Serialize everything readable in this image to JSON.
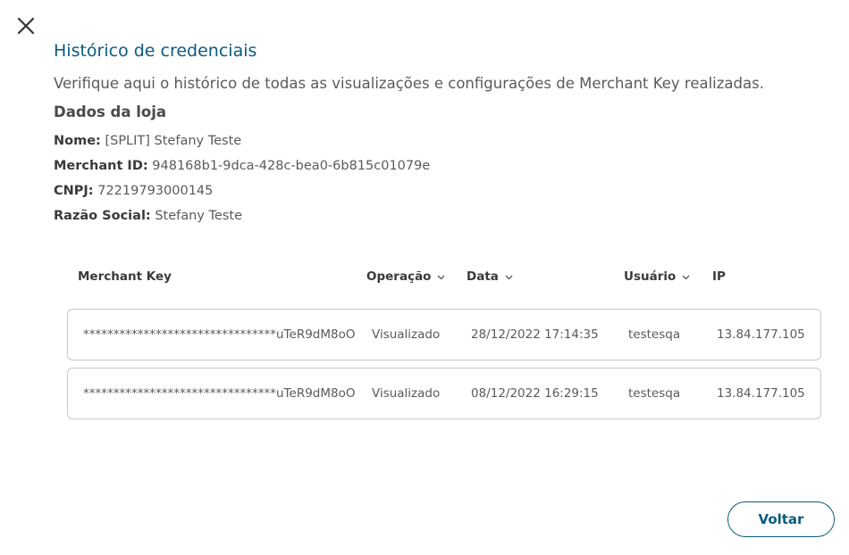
{
  "modal": {
    "title": "Histórico de credenciais",
    "subtitle": "Verifique aqui o histórico de todas as visualizações e configurações de Merchant Key realizadas.",
    "close_icon": "close-icon"
  },
  "store": {
    "section_title": "Dados da loja",
    "fields": [
      {
        "label": "Nome:",
        "value": "[SPLIT] Stefany Teste"
      },
      {
        "label": "Merchant ID:",
        "value": "948168b1-9dca-428c-bea0-6b815c01079e"
      },
      {
        "label": "CNPJ:",
        "value": "72219793000145"
      },
      {
        "label": "Razão Social:",
        "value": "Stefany Teste"
      }
    ]
  },
  "table": {
    "columns": [
      {
        "label": "Merchant Key",
        "sortable": false
      },
      {
        "label": "Operação",
        "sortable": true
      },
      {
        "label": "Data",
        "sortable": true
      },
      {
        "label": "Usuário",
        "sortable": true
      },
      {
        "label": "IP",
        "sortable": false
      }
    ],
    "rows": [
      {
        "merchant_key": "********************************uTeR9dM8oO",
        "operacao": "Visualizado",
        "data": "28/12/2022 17:14:35",
        "usuario": "testesqa",
        "ip": "13.84.177.105"
      },
      {
        "merchant_key": "********************************uTeR9dM8oO",
        "operacao": "Visualizado",
        "data": "08/12/2022 16:29:15",
        "usuario": "testesqa",
        "ip": "13.84.177.105"
      }
    ]
  },
  "footer": {
    "back_label": "Voltar"
  },
  "colors": {
    "accent": "#0b5a7e",
    "text": "#5a5a5a",
    "border": "#c8c8c8"
  }
}
